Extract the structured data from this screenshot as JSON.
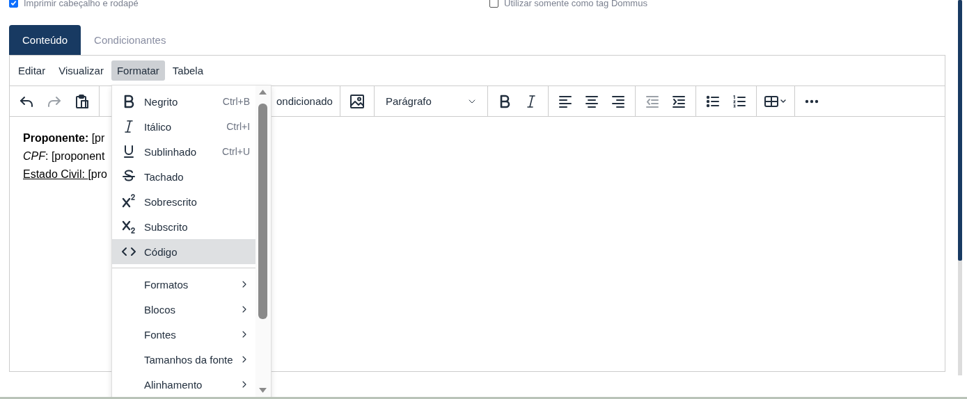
{
  "options": [
    {
      "label": "Imprimir cabeçalho e rodapé",
      "checked": true
    },
    {
      "label": "Utilizar somente como tag Dommus",
      "checked": false
    }
  ],
  "tabs": [
    {
      "label": "Conteúdo",
      "selected": true
    },
    {
      "label": "Condicionantes",
      "selected": false
    }
  ],
  "menubar": [
    {
      "label": "Editar",
      "selected": false
    },
    {
      "label": "Visualizar",
      "selected": false
    },
    {
      "label": "Formatar",
      "selected": true
    },
    {
      "label": "Tabela",
      "selected": false
    }
  ],
  "toolbar": [
    [
      {
        "kind": "undo",
        "disabled": false
      },
      {
        "kind": "redo",
        "disabled": true
      },
      {
        "kind": "paste",
        "disabled": false
      }
    ],
    [
      {
        "kind": "text",
        "label": "ondicionado",
        "disabled": false
      }
    ],
    [
      {
        "kind": "image",
        "disabled": false
      }
    ],
    [
      {
        "kind": "select",
        "value": "Parágrafo",
        "disabled": false
      }
    ],
    [
      {
        "kind": "bold",
        "disabled": false
      },
      {
        "kind": "italic",
        "disabled": false
      }
    ],
    [
      {
        "kind": "align-left",
        "disabled": false
      },
      {
        "kind": "align-center",
        "disabled": false
      },
      {
        "kind": "align-right",
        "disabled": false
      }
    ],
    [
      {
        "kind": "outdent",
        "disabled": true
      },
      {
        "kind": "indent",
        "disabled": false
      }
    ],
    [
      {
        "kind": "bullet-list",
        "disabled": false
      },
      {
        "kind": "numbered-list",
        "disabled": false
      }
    ],
    [
      {
        "kind": "table",
        "disabled": false
      }
    ],
    [
      {
        "kind": "more",
        "disabled": false
      }
    ]
  ],
  "content": [
    [
      {
        "text": "Proponente:",
        "kind": "bold"
      },
      {
        "text": " [pr",
        "kind": "plain"
      }
    ],
    [
      {
        "text": "CPF",
        "kind": "italic"
      },
      {
        "text": ": [proponent",
        "kind": "plain"
      }
    ],
    [
      {
        "text": "Estado Civil: ",
        "kind": "underline"
      },
      {
        "text": "[pro",
        "kind": "plain"
      }
    ]
  ],
  "format_menu": [
    {
      "kind": "format",
      "label": "Negrito",
      "shortcut": "Ctrl+B",
      "selected": false
    },
    {
      "kind": "format",
      "label": "Itálico",
      "shortcut": "Ctrl+I",
      "selected": false
    },
    {
      "kind": "format",
      "label": "Sublinhado",
      "shortcut": "Ctrl+U",
      "selected": false
    },
    {
      "kind": "format",
      "label": "Tachado",
      "selected": false
    },
    {
      "kind": "format",
      "label": "Sobrescrito",
      "selected": false
    },
    {
      "kind": "format",
      "label": "Subscrito",
      "selected": false
    },
    {
      "kind": "format",
      "label": "Código",
      "selected": true
    },
    {
      "kind": "divider"
    },
    {
      "kind": "submenu",
      "label": "Formatos",
      "selected": false
    },
    {
      "kind": "submenu",
      "label": "Blocos",
      "selected": false
    },
    {
      "kind": "submenu",
      "label": "Fontes",
      "selected": false
    },
    {
      "kind": "submenu",
      "label": "Tamanhos da fonte",
      "selected": false
    },
    {
      "kind": "submenu",
      "label": "Alinhamento",
      "selected": false
    }
  ]
}
